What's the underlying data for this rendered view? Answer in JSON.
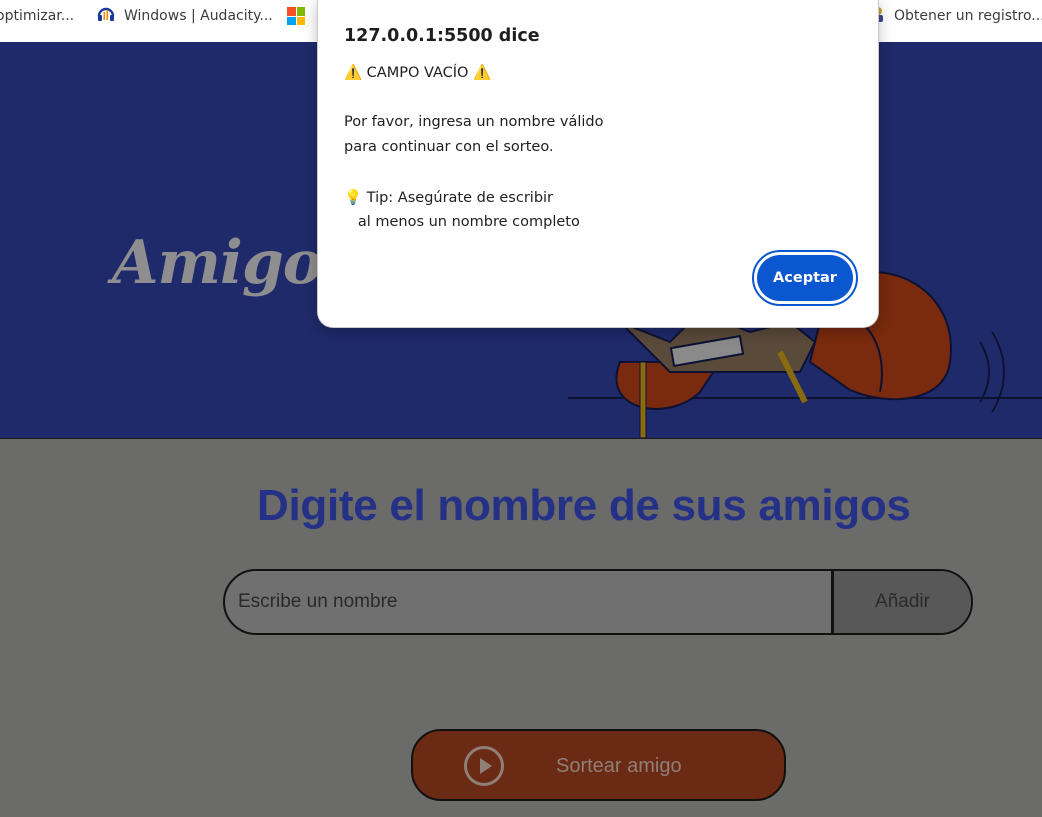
{
  "bookmarks": {
    "items": [
      {
        "label": "optimizar...",
        "icon": "bookmark-page-icon"
      },
      {
        "label": "Windows | Audacity...",
        "icon": "audacity-icon"
      },
      {
        "label": "",
        "icon": "microsoft-logo-icon"
      },
      {
        "label": "Obtener un registro...",
        "icon": "bookmark-favicon-icon"
      }
    ]
  },
  "hero": {
    "title": "Amigo"
  },
  "main": {
    "heading": "Digite el nombre de sus amigos",
    "input_placeholder": "Escribe un nombre",
    "add_button": "Añadir",
    "draw_button": "Sortear amigo",
    "draw_icon": "play-circle-icon"
  },
  "dialog": {
    "origin": "127.0.0.1:5500 dice",
    "line1": "⚠️ CAMPO VACÍO ⚠️",
    "line2": "Por favor, ingresa un nombre válido",
    "line3": "para continuar con el sorteo.",
    "line4": "💡 Tip: Asegúrate de escribir",
    "line5": "   al menos un nombre completo",
    "ok_button": "Aceptar"
  },
  "colors": {
    "hero_bg": "#1f2a6b",
    "overlay_bg": "#6b6b69",
    "heading": "#243186",
    "draw_button_bg": "#6b2a13",
    "dialog_button": "#0b57d0"
  }
}
